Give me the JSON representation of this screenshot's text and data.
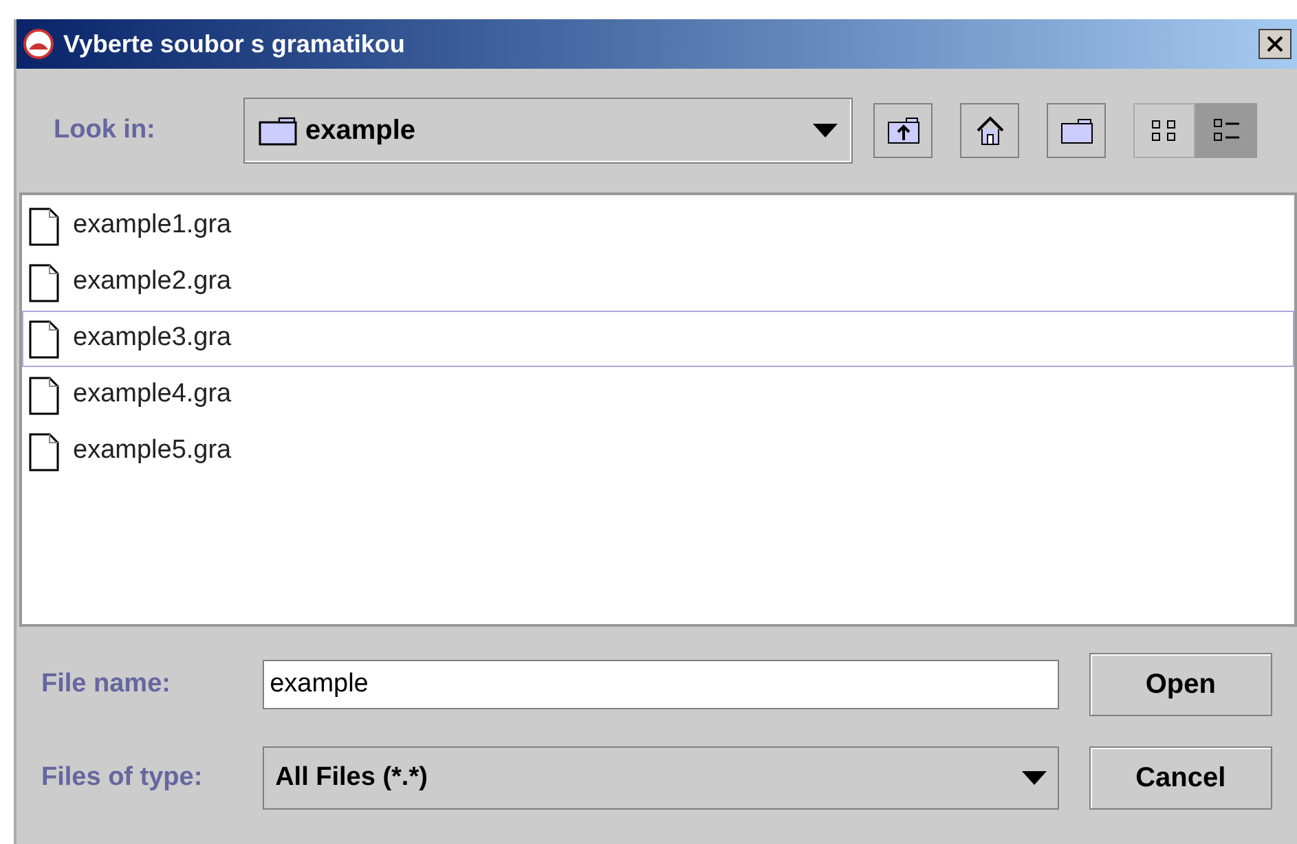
{
  "window": {
    "title": "Vyberte soubor s gramatikou"
  },
  "look_in": {
    "label": "Look in:",
    "value": "example"
  },
  "toolbar": [
    {
      "kind": "up",
      "selected": false
    },
    {
      "kind": "home",
      "selected": false
    },
    {
      "kind": "new-folder",
      "selected": false
    },
    {
      "kind": "list-view",
      "selected": false
    },
    {
      "kind": "details-view",
      "selected": true
    }
  ],
  "files": [
    {
      "name": "example1.gra",
      "focused": false
    },
    {
      "name": "example2.gra",
      "focused": false
    },
    {
      "name": "example3.gra",
      "focused": true
    },
    {
      "name": "example4.gra",
      "focused": false
    },
    {
      "name": "example5.gra",
      "focused": false
    }
  ],
  "file_name": {
    "label": "File name:",
    "value": "example"
  },
  "file_type": {
    "label": "Files of type:",
    "value": "All Files (*.*)"
  },
  "buttons": [
    "Open",
    "Cancel"
  ]
}
